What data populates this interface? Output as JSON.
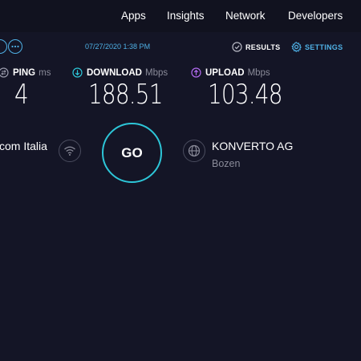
{
  "nav": {
    "items": [
      "Apps",
      "Insights",
      "Network",
      "Developers"
    ]
  },
  "toolbar": {
    "datetime": "07/27/2020 1:38 PM",
    "results_label": "RESULTS",
    "settings_label": "SETTINGS"
  },
  "metrics": {
    "ping": {
      "label": "PING",
      "unit": "ms",
      "value": "4"
    },
    "download": {
      "label": "DOWNLOAD",
      "unit": "Mbps",
      "value": "188.51"
    },
    "upload": {
      "label": "UPLOAD",
      "unit": "Mbps",
      "value": "103.48"
    }
  },
  "isp": {
    "name": "com Italia"
  },
  "go_button": {
    "label": "GO"
  },
  "server": {
    "name": "KONVERTO AG",
    "location": "Bozen"
  },
  "colors": {
    "background": "#141526",
    "accent_blue": "#4fb1e6",
    "accent_cyan": "#2dc6d8",
    "upload_purple": "#b26bf0",
    "muted_text": "#8a8b99"
  },
  "icons": {
    "wifi": "wifi-icon",
    "globe": "globe-icon",
    "check": "check-circle-icon",
    "gear": "gear-icon",
    "download": "download-arrow-icon",
    "upload": "upload-arrow-icon",
    "ping": "ping-icon"
  }
}
